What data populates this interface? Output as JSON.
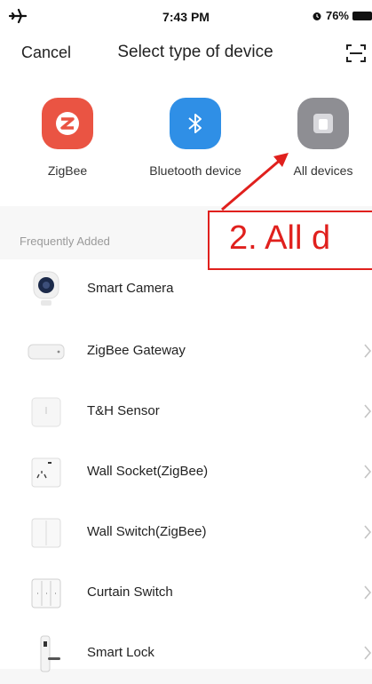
{
  "status_bar": {
    "time": "7:43 PM",
    "battery": "76%",
    "left_icon": "airplane-icon",
    "alarm_icon": "alarm-icon",
    "battery_icon": "battery-icon"
  },
  "nav": {
    "cancel_label": "Cancel",
    "title": "Select type of device",
    "scan_icon": "scan-icon"
  },
  "categories": [
    {
      "label": "ZigBee",
      "icon": "zigbee-icon",
      "color": "#e8513f"
    },
    {
      "label": "Bluetooth device",
      "icon": "bluetooth-icon",
      "color": "#2f8fe6"
    },
    {
      "label": "All devices",
      "icon": "all-devices-icon",
      "color": "#8e8e93"
    }
  ],
  "section": {
    "label": "Frequently Added"
  },
  "devices": [
    {
      "label": "Smart Camera",
      "icon": "camera-icon",
      "chevron": false
    },
    {
      "label": "ZigBee Gateway",
      "icon": "gateway-icon",
      "chevron": true
    },
    {
      "label": "T&H Sensor",
      "icon": "sensor-icon",
      "chevron": true
    },
    {
      "label": "Wall Socket(ZigBee)",
      "icon": "socket-icon",
      "chevron": true
    },
    {
      "label": "Wall Switch(ZigBee)",
      "icon": "switch-icon",
      "chevron": true
    },
    {
      "label": "Curtain Switch",
      "icon": "curtain-switch-icon",
      "chevron": true
    },
    {
      "label": "Smart Lock",
      "icon": "lock-icon",
      "chevron": true
    }
  ],
  "annotation": {
    "text": "2. All d",
    "color": "#e0201d"
  }
}
